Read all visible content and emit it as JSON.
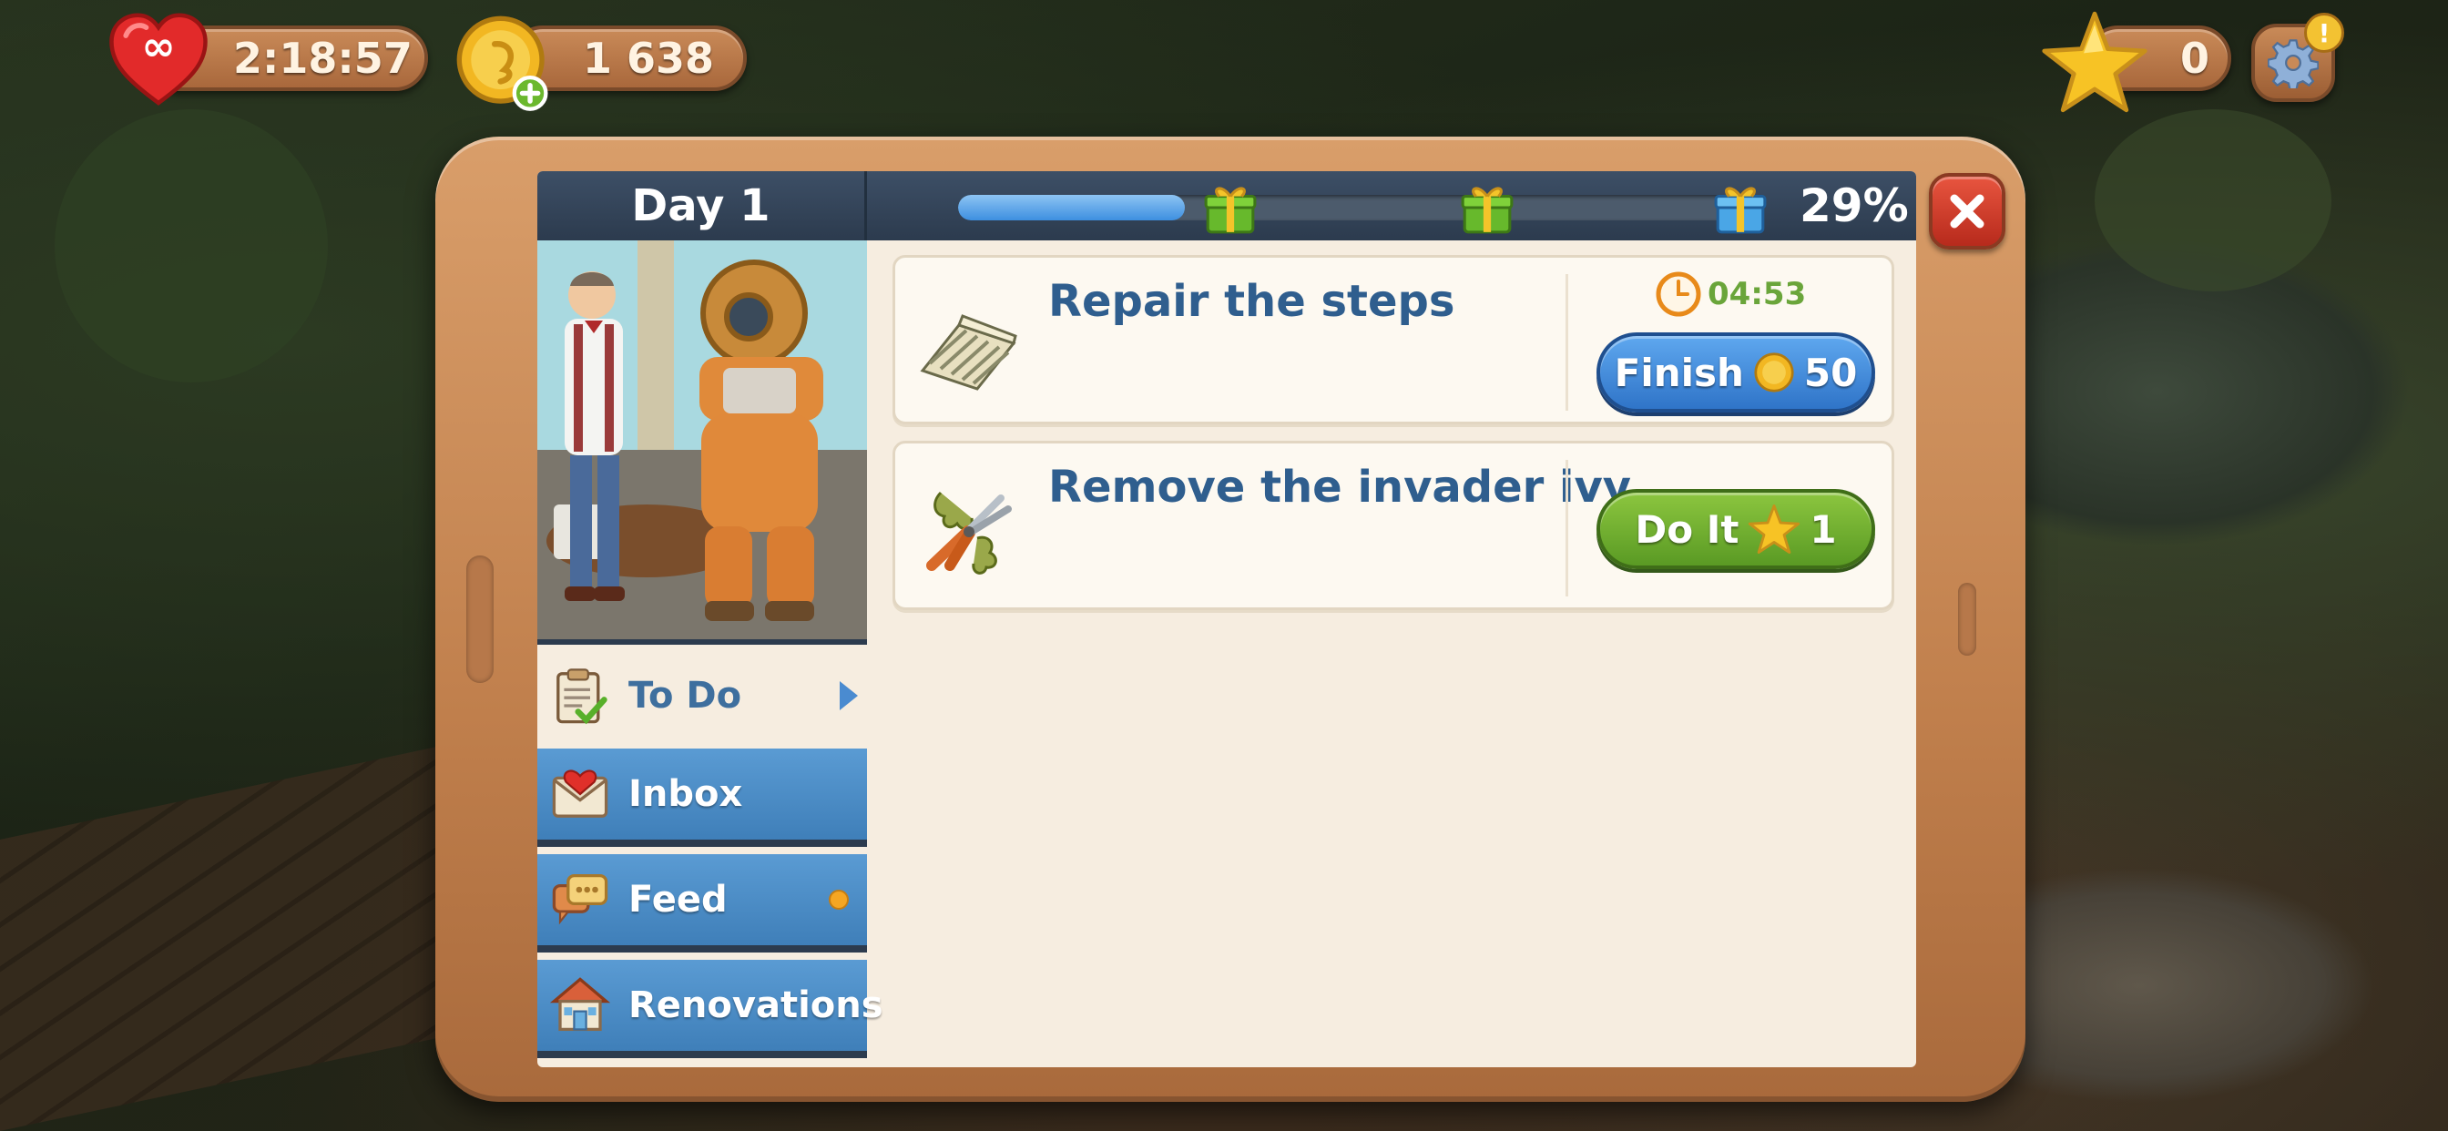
{
  "hud": {
    "lives_timer": "2:18:57",
    "coins": "1 638",
    "stars": "0",
    "settings_alert": "!"
  },
  "panel": {
    "title": "Day 1",
    "progress_percent": "29%",
    "progress_value": 0.29
  },
  "sidebar": {
    "items": [
      {
        "label": "To Do",
        "active": true
      },
      {
        "label": "Inbox",
        "active": false
      },
      {
        "label": "Feed",
        "active": false,
        "has_notification": true
      },
      {
        "label": "Renovations",
        "active": false
      }
    ]
  },
  "tasks": [
    {
      "title": "Repair the steps",
      "timer": "04:53",
      "button_label": "Finish",
      "cost": "50",
      "cost_type": "coin"
    },
    {
      "title": "Remove the invader ivy",
      "button_label": "Do It",
      "cost": "1",
      "cost_type": "star"
    }
  ],
  "colors": {
    "accent_blue": "#3f7fb9",
    "title_blue": "#2f5e8e",
    "green_button": "#6aa53a",
    "frame": "#c07f4c"
  },
  "icons": [
    "heart-icon",
    "coin-icon",
    "star-icon",
    "gear-icon",
    "gift-icon",
    "close-icon",
    "clipboard-icon",
    "envelope-icon",
    "chat-icon",
    "house-icon",
    "steps-icon",
    "shears-icon",
    "clock-icon"
  ]
}
